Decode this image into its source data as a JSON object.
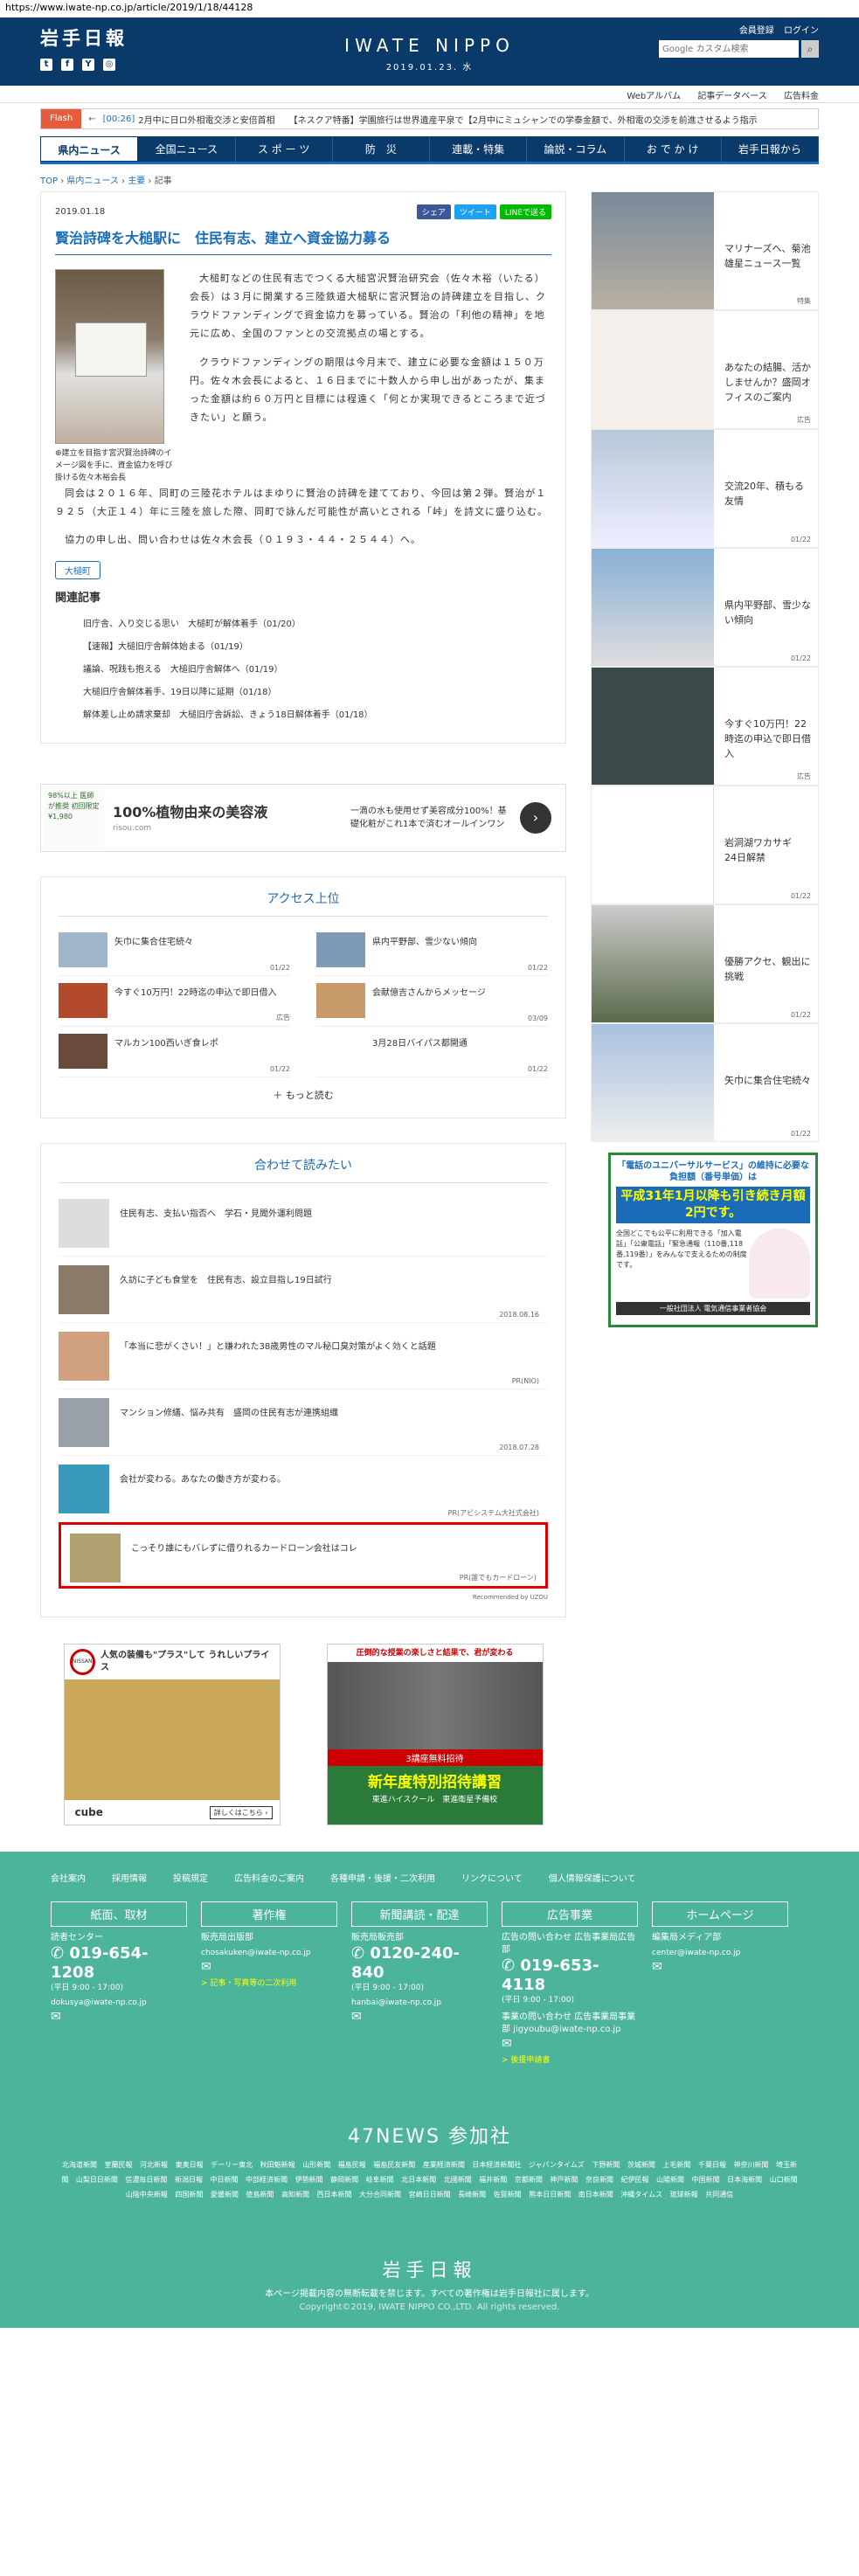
{
  "browser": {
    "url": "https://www.iwate-np.co.jp/article/2019/1/18/44128"
  },
  "header": {
    "logo": "岩手日報",
    "brand_name": "IWATE NIPPO",
    "brand_date": "2019.01.23. 水",
    "links": [
      "会員登録",
      "ログイン"
    ],
    "search_placeholder": "Google カスタム検索",
    "social": [
      "t",
      "f",
      "Y",
      "◎"
    ]
  },
  "subnav": [
    "Webアルバム",
    "記事データベース",
    "広告料金"
  ],
  "flash": {
    "tag": "Flash",
    "stamp": "[00:26]",
    "items": [
      "2月中に日ロ外相電交渉と安倍首相",
      "【ネスクア特番】学園旅行は世界遺産平泉で【2月中にミュシャンでの学泰金額で、外相電の交渉を前進させるよう指示"
    ]
  },
  "gnav": [
    "県内ニュース",
    "全国ニュース",
    "ス ポ ー ツ",
    "防　災",
    "連載・特集",
    "論説・コラム",
    "お で か け",
    "岩手日報から"
  ],
  "breadcrumb": {
    "items": [
      "TOP",
      "県内ニュース",
      "主要"
    ],
    "current": "記事"
  },
  "article": {
    "date": "2019.01.18",
    "share": [
      "シェア",
      "ツイート",
      "LINEで送る"
    ],
    "title": "賢治詩碑を大槌駅に　住民有志、建立へ資金協力募る",
    "caption": "建立を目指す宮沢賢治詩碑のイメージ図を手に、資金協力を呼び掛ける佐々木裕会長",
    "paragraphs": [
      "大槌町などの住民有志でつくる大槌宮沢賢治研究会（佐々木裕（いたる）会長）は３月に開業する三陸鉄道大槌駅に宮沢賢治の詩碑建立を目指し、クラウドファンディングで資金協力を募っている。賢治の「利他の精神」を地元に広め、全国のファンとの交流拠点の場とする。",
      "クラウドファンディングの期限は今月末で、建立に必要な金額は１５０万円。佐々木会長によると、１６日までに十数人から申し出があったが、集まった金額は約６０万円と目標には程遠く「何とか実現できるところまで近づきたい」と願う。",
      "同会は２０１６年、同町の三陸花ホテルはまゆりに賢治の詩碑を建てており、今回は第２弾。賢治が１９２５（大正１４）年に三陸を旅した際、同町で詠んだ可能性が高いとされる「峠」を詩文に盛り込む。"
    ],
    "contact": "協力の申し出、問い合わせは佐々木会長（０１９３・４４・２５４４）へ。",
    "tag": "大槌町",
    "related_heading": "関連記事",
    "related": [
      "旧庁舎、入り交じる思い　大槌町が解体着手（01/20）",
      "【速報】大槌旧庁舎解体始まる（01/19）",
      "議論、呪践も抱える　大槌旧庁舎解体へ（01/19）",
      "大槌旧庁舎解体着手、19日以降に延期（01/18）",
      "解体差し止め請求棄却　大槌旧庁舎訴訟、きょう18日解体着手（01/18）"
    ]
  },
  "ad_banner": {
    "thumb": "98%以上 医師が推奨 初回限定¥1,980",
    "title": "100%植物由来の美容液",
    "domain": "risou.com",
    "desc": "一滴の水も使用せず美容成分100%！基礎化粧がこれ1本で済むオールインワン",
    "go": "›"
  },
  "access": {
    "heading": "アクセス上位",
    "items": [
      {
        "title": "矢巾に集合住宅続々",
        "date": "01/22"
      },
      {
        "title": "県内平野部、雪少ない傾向",
        "date": "01/22"
      },
      {
        "title": "今すぐ10万円！22時迄の申込で即日借入",
        "date": "広告"
      },
      {
        "title": "会献億吉さんからメッセージ",
        "date": "03/09"
      },
      {
        "title": "マルカン100西いぎ食レポ",
        "date": "01/22"
      },
      {
        "title": "3月28日バイパス都開通",
        "date": "01/22"
      }
    ],
    "more": "もっと読む"
  },
  "recommend": {
    "heading": "合わせて読みたい",
    "items": [
      {
        "title": "住民有志、支払い指否へ　学石・見聞外運利問題",
        "date": ""
      },
      {
        "title": "久訪に子ども食堂を　住民有志、設立目指し19日試行",
        "date": "2018.08.16"
      },
      {
        "title": "「本当に悲がくさい！」と嫌われた38歳男性のマル秘口臭対策がよく効くと話題",
        "date": "PR(NIO)"
      },
      {
        "title": "マンション修繕、悩み共有　盛岡の住民有志が連携組織",
        "date": "2018.07.28"
      },
      {
        "title": "会社が変わる。あなたの働き方が変わる。",
        "date": "PR(アビシステム大社式会社)"
      },
      {
        "title": "こっそり誰にもバレずに借りれるカードローン会社はコレ",
        "date": "PR(誰でもカードローン)"
      }
    ],
    "powered": "Recommended by UZOU"
  },
  "ads_bottom": {
    "nissan_title": "人気の装備も\"プラス\"して うれしいプライス",
    "nissan_logo": "NISSAN",
    "nissan_car": "cube",
    "nissan_more": "詳しくはこちら ›",
    "school_head": "圧倒的な授業の楽しさと結果で、君が変わる",
    "school_red": "3講座無料招待",
    "school_big": "新年度特別招待講習",
    "school_small": "東進ハイスクール　東進衛星予備校"
  },
  "sidebar": {
    "items": [
      {
        "title": "マリナーズへ、菊池雄星ニュース一覧",
        "date": "特集"
      },
      {
        "title": "あなたの結腸、活かしませんか？盛岡オフィスのご案内",
        "date": "広告"
      },
      {
        "title": "交流20年、積もる友情",
        "date": "01/22"
      },
      {
        "title": "県内平野部、雪少ない傾向",
        "date": "01/22"
      },
      {
        "title": "今すぐ10万円！22時迄の申込で即日借入",
        "date": "広告"
      },
      {
        "title": "岩洞湖ワカサギ　24日解禁",
        "date": "01/22"
      },
      {
        "title": "優勝アクセ、観出に挑戦",
        "date": "01/22"
      },
      {
        "title": "矢巾に集合住宅続々",
        "date": "01/22"
      }
    ],
    "ad": {
      "h1": "「電話のユニバーサルサービス」の維持に必要な負担額（番号単価）は",
      "h2": "平成31年1月以降も引き続き月額2円です。",
      "text": "全国どこでも公平に利用できる「加入電話」「公衆電話」「緊急通報（110番,118番,119番）」をみんなで支えるための制度です。",
      "footer": "一般社団法人 電気通信事業者協会"
    }
  },
  "footer": {
    "links": [
      "会社案内",
      "採用情報",
      "投稿規定",
      "広告料金のご案内",
      "各種申請・後援・二次利用",
      "リンクについて",
      "個人情報保護について"
    ],
    "cols": [
      {
        "heading": "紙面、取材",
        "label": "読者センター",
        "tel": "019-654-1208",
        "hours": "(平日 9:00 - 17:00)",
        "mail": "dokusya@iwate-np.co.jp",
        "extra": ""
      },
      {
        "heading": "著作権",
        "label": "販売局出版部",
        "tel": "",
        "hours": "",
        "mail": "chosakuken@iwate-np.co.jp",
        "extra": "> 記事・写真等の二次利用"
      },
      {
        "heading": "新聞講読・配達",
        "label": "販売局販売部",
        "tel": "0120-240-840",
        "hours": "(平日 9:00 - 17:00)",
        "mail": "hanbai@iwate-np.co.jp",
        "extra": ""
      },
      {
        "heading": "広告事業",
        "label": "広告の問い合わせ 広告事業局広告部",
        "tel": "019-653-4118",
        "hours": "(平日 9:00 - 17:00)",
        "mail": "",
        "extra": "事業の問い合わせ 広告事業局事業部 jigyoubu@iwate-np.co.jp",
        "extra2": "> 後援申請書"
      },
      {
        "heading": "ホームページ",
        "label": "編集局メディア部",
        "tel": "",
        "hours": "",
        "mail": "center@iwate-np.co.jp",
        "extra": ""
      }
    ],
    "news47": "47NEWS 参加社",
    "papers": "北海道新聞 室蘭民報 河北新報 東奥日報 デーリー東北 秋田魁新報 山形新聞 福島民報 福島民友新聞 産業経済新聞 日本経済新聞社 ジャパンタイムズ 下野新聞 茨城新聞 上毛新聞 千葉日報 神奈川新聞 埼玉新聞 山梨日日新聞 信濃毎日新聞 新潟日報 中日新聞 中部経済新聞 伊勢新聞 静岡新聞 岐阜新聞 北日本新聞 北國新聞 福井新聞 京都新聞 神戸新聞 奈良新聞 紀伊民報 山陽新聞 中国新聞 日本海新聞 山口新聞 山陰中央新報 四国新聞 愛媛新聞 徳島新聞 高知新聞 西日本新聞 大分合同新聞 宮崎日日新聞 長崎新聞 佐賀新聞 熊本日日新聞 南日本新聞 沖縄タイムス 琉球新報 共同通信",
    "logo": "岩手日報",
    "note": "本ページ掲載内容の無断転載を禁じます。すべての著作権は岩手日報社に属します。",
    "copyright": "Copyright©2019, IWATE NIPPO CO.,LTD. All rights reserved."
  }
}
